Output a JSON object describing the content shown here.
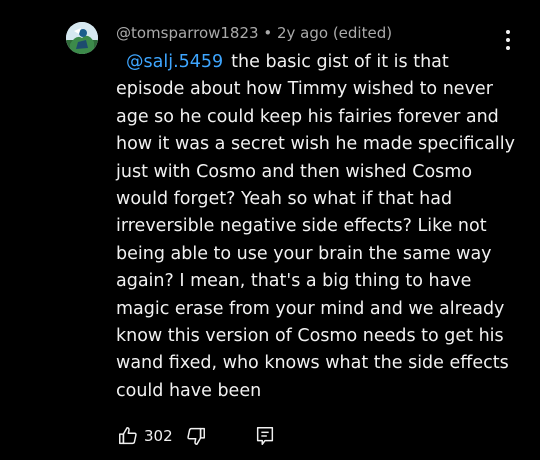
{
  "comment": {
    "author": "@tomsparrow1823",
    "separator": "•",
    "time": "2y ago (edited)",
    "mention": "@salj.5459",
    "text": "the basic gist of it is that episode about how Timmy wished to never age so he could keep his fairies forever and how it was a secret wish he made specifically just with Cosmo and then wished Cosmo would forget? Yeah so what if that had irreversible negative side effects? Like not being able to use your brain the same way again? I mean, that's a big thing to have magic erase from your mind and we already know this version of Cosmo needs to get his wand fixed, who knows what the side effects could have been",
    "like_count": "302"
  },
  "icons": {
    "avatar": "avatar-image",
    "more": "more-vertical-icon",
    "like": "thumbs-up-icon",
    "dislike": "thumbs-down-icon",
    "reply": "reply-comment-icon"
  },
  "colors": {
    "background": "#000000",
    "text": "#f1f1f1",
    "meta": "#aaaaaa",
    "mention": "#3ea6ff"
  }
}
